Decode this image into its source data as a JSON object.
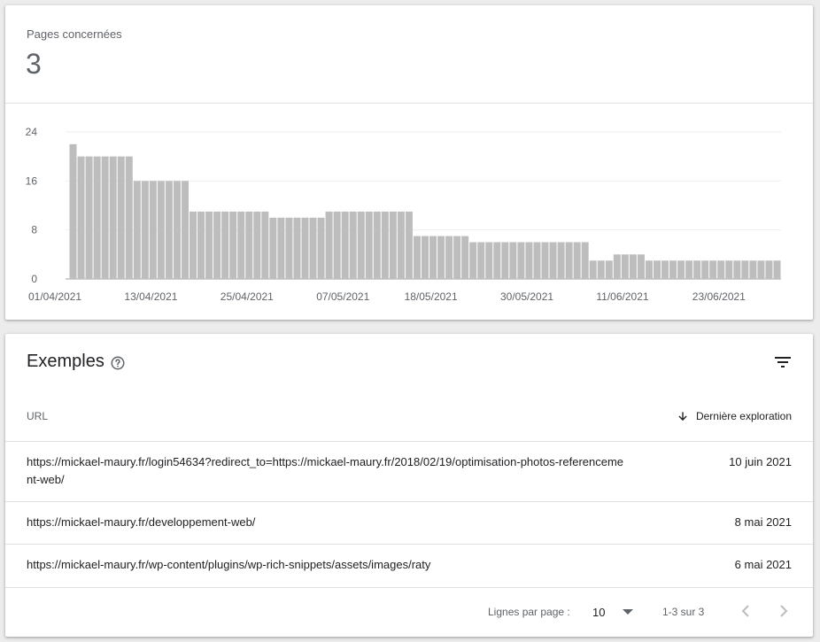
{
  "summary": {
    "label": "Pages concernées",
    "value": "3"
  },
  "chart_data": {
    "type": "bar",
    "yticks": [
      0,
      8,
      16,
      24
    ],
    "ylim": [
      0,
      24
    ],
    "xtick_labels": [
      "01/04/2021",
      "13/04/2021",
      "25/04/2021",
      "07/05/2021",
      "18/05/2021",
      "30/05/2021",
      "11/06/2021",
      "23/06/2021"
    ],
    "xtick_indices": [
      0,
      12,
      24,
      36,
      47,
      59,
      71,
      83
    ],
    "values": [
      22,
      20,
      20,
      20,
      20,
      20,
      20,
      20,
      16,
      16,
      16,
      16,
      16,
      16,
      16,
      11,
      11,
      11,
      11,
      11,
      11,
      11,
      11,
      11,
      11,
      10,
      10,
      10,
      10,
      10,
      10,
      10,
      11,
      11,
      11,
      11,
      11,
      11,
      11,
      11,
      11,
      11,
      11,
      7,
      7,
      7,
      7,
      7,
      7,
      7,
      6,
      6,
      6,
      6,
      6,
      6,
      6,
      6,
      6,
      6,
      6,
      6,
      6,
      6,
      6,
      3,
      3,
      3,
      4,
      4,
      4,
      4,
      3,
      3,
      3,
      3,
      3,
      3,
      3,
      3,
      3,
      3,
      3,
      3,
      3,
      3,
      3,
      3,
      3
    ],
    "bar_color": "#bdbdbd",
    "grid": true
  },
  "examples": {
    "title": "Exemples",
    "help_icon": "help-circle-icon",
    "filter_icon": "filter-icon",
    "columns": {
      "url": "URL",
      "date": "Dernière exploration"
    },
    "rows": [
      {
        "url": "https://mickael-maury.fr/login54634?redirect_to=https://mickael-maury.fr/2018/02/19/optimisation-photos-referencement-web/",
        "date": "10 juin 2021"
      },
      {
        "url": "https://mickael-maury.fr/developpement-web/",
        "date": "8 mai 2021"
      },
      {
        "url": "https://mickael-maury.fr/wp-content/plugins/wp-rich-snippets/assets/images/raty",
        "date": "6 mai 2021"
      }
    ],
    "pagination": {
      "rows_per_page_label": "Lignes par page :",
      "rows_per_page_value": "10",
      "range": "1-3 sur 3"
    }
  }
}
